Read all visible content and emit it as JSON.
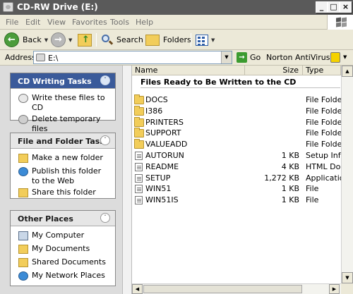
{
  "window": {
    "title": "CD-RW Drive (E:)"
  },
  "menubar": {
    "items": [
      "File",
      "Edit",
      "View",
      "Favorites",
      "Tools",
      "Help"
    ]
  },
  "toolbar": {
    "back_label": "Back",
    "search_label": "Search",
    "folders_label": "Folders"
  },
  "addressbar": {
    "label": "Address",
    "path": "E:\\",
    "go_label": "Go",
    "norton_label": "Norton AntiVirus"
  },
  "left_panels": {
    "cd_writing": {
      "title": "CD Writing Tasks",
      "items": [
        {
          "label": "Write these files to CD",
          "icon": "write-cd-icon"
        },
        {
          "label": "Delete temporary files",
          "icon": "delete-temp-icon"
        }
      ]
    },
    "file_folder": {
      "title": "File and Folder Tasks",
      "items": [
        {
          "label": "Make a new folder",
          "icon": "new-folder-icon"
        },
        {
          "label": "Publish this folder to the Web",
          "icon": "publish-web-icon"
        },
        {
          "label": "Share this folder",
          "icon": "share-folder-icon"
        }
      ]
    },
    "other_places": {
      "title": "Other Places",
      "items": [
        {
          "label": "My Computer",
          "icon": "my-computer-icon"
        },
        {
          "label": "My Documents",
          "icon": "my-documents-icon"
        },
        {
          "label": "Shared Documents",
          "icon": "shared-documents-icon"
        },
        {
          "label": "My Network Places",
          "icon": "network-places-icon"
        }
      ]
    }
  },
  "file_list": {
    "columns": {
      "name": "Name",
      "size": "Size",
      "type": "Type"
    },
    "group_title": "Files Ready to Be Written to the CD",
    "rows": [
      {
        "name": "DOCS",
        "size": "",
        "type": "File Folder",
        "kind": "folder"
      },
      {
        "name": "I386",
        "size": "",
        "type": "File Folder",
        "kind": "folder"
      },
      {
        "name": "PRINTERS",
        "size": "",
        "type": "File Folder",
        "kind": "folder"
      },
      {
        "name": "SUPPORT",
        "size": "",
        "type": "File Folder",
        "kind": "folder"
      },
      {
        "name": "VALUEADD",
        "size": "",
        "type": "File Folder",
        "kind": "folder"
      },
      {
        "name": "AUTORUN",
        "size": "1 KB",
        "type": "Setup Information",
        "kind": "file"
      },
      {
        "name": "README",
        "size": "4 KB",
        "type": "HTML Document",
        "kind": "file"
      },
      {
        "name": "SETUP",
        "size": "1,272 KB",
        "type": "Application",
        "kind": "file"
      },
      {
        "name": "WIN51",
        "size": "1 KB",
        "type": "File",
        "kind": "file"
      },
      {
        "name": "WIN51IS",
        "size": "1 KB",
        "type": "File",
        "kind": "file"
      }
    ]
  }
}
